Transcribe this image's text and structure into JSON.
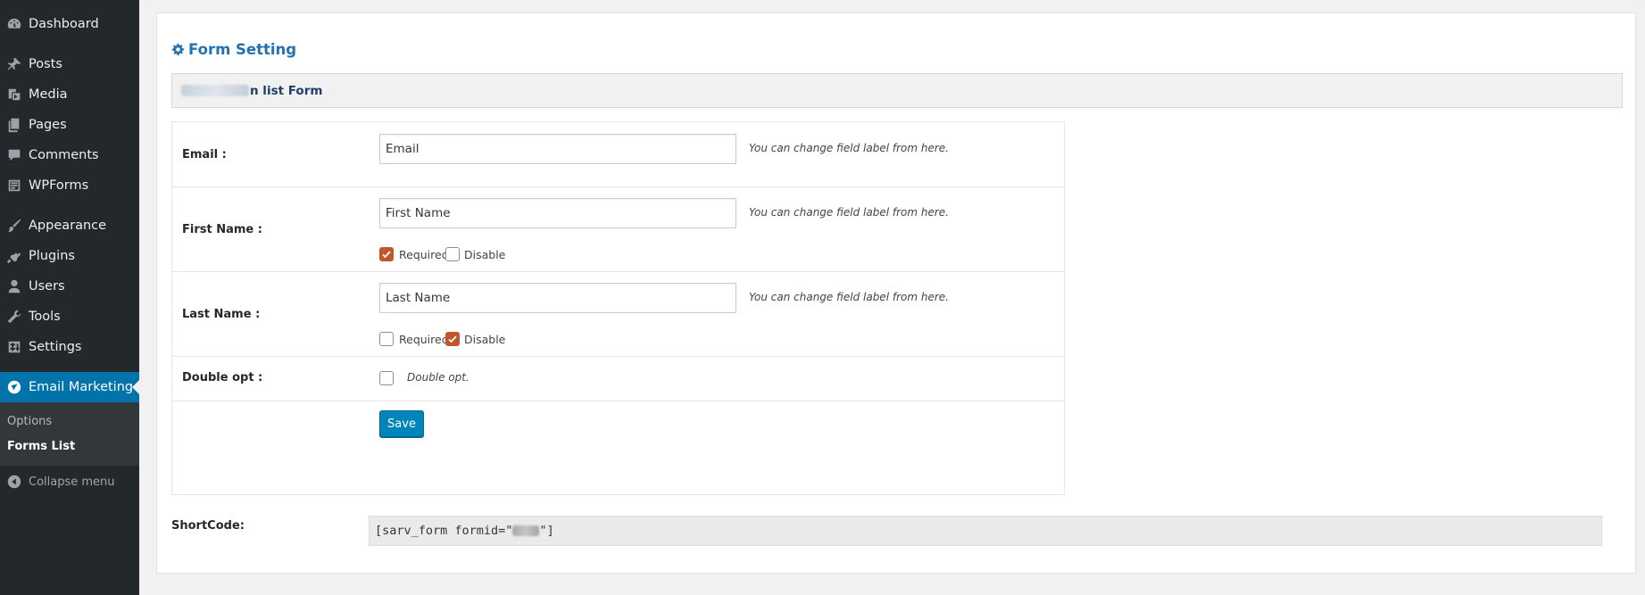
{
  "sidebar": {
    "items": [
      {
        "label": "Dashboard",
        "icon": "dashboard-icon"
      },
      {
        "label": "Posts",
        "icon": "pin-icon"
      },
      {
        "label": "Media",
        "icon": "media-icon"
      },
      {
        "label": "Pages",
        "icon": "pages-icon"
      },
      {
        "label": "Comments",
        "icon": "comment-icon"
      },
      {
        "label": "WPForms",
        "icon": "forms-icon"
      },
      {
        "label": "Appearance",
        "icon": "brush-icon"
      },
      {
        "label": "Plugins",
        "icon": "plugin-icon"
      },
      {
        "label": "Users",
        "icon": "user-icon"
      },
      {
        "label": "Tools",
        "icon": "wrench-icon"
      },
      {
        "label": "Settings",
        "icon": "settings-icon"
      },
      {
        "label": "Email Marketing",
        "icon": "email-marketing-icon"
      }
    ],
    "submenu": [
      {
        "label": "Options"
      },
      {
        "label": "Forms List"
      }
    ],
    "collapse_label": "Collapse menu",
    "active_color": "#0073aa"
  },
  "main": {
    "heading": "Form Setting",
    "form_bar_title_visible": "n list Form",
    "fields": [
      {
        "label": "Email :",
        "value": "Email",
        "hint": "You can change field label from here."
      },
      {
        "label": "First Name :",
        "value": "First Name",
        "hint": "You can change field label from here.",
        "required_label": "Required",
        "required": true,
        "disable_label": "Disable",
        "disable": false
      },
      {
        "label": "Last Name :",
        "value": "Last Name",
        "hint": "You can change field label from here.",
        "required_label": "Required",
        "required": false,
        "disable_label": "Disable",
        "disable": true
      }
    ],
    "double_opt": {
      "label": "Double opt :",
      "checkbox_label": "Double opt.",
      "checked": false
    },
    "save_label": "Save",
    "shortcode": {
      "label": "ShortCode:",
      "prefix": "[sarv_form formid=\"",
      "suffix": "\"]"
    },
    "accent_color": "#0085ba",
    "checkbox_color": "#c2562a"
  }
}
